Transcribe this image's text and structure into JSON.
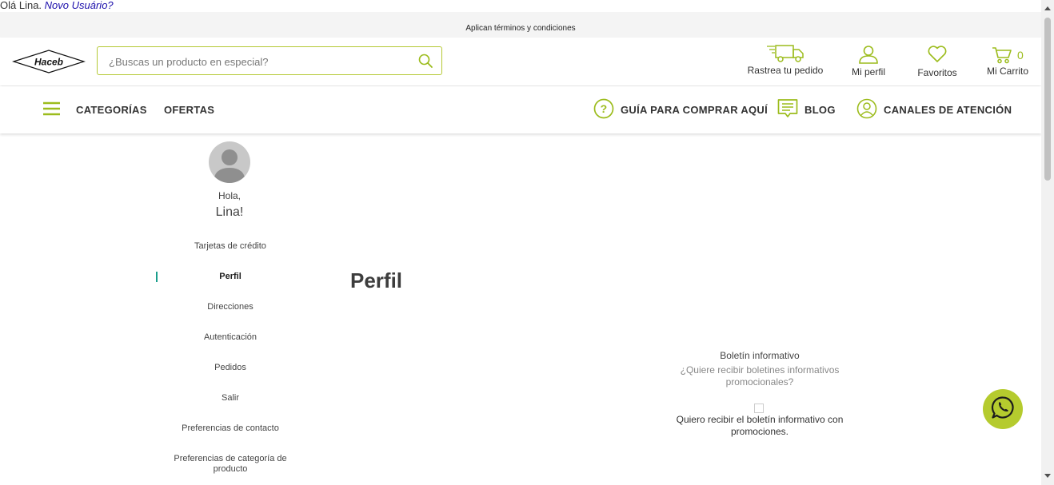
{
  "greeting": {
    "text": "Olá Lina.",
    "link": "Novo Usuário?"
  },
  "promo_bar": {
    "text": "Aplican términos y condiciones"
  },
  "header": {
    "logo_text": "Haceb",
    "search_placeholder": "¿Buscas un producto en especial?",
    "track_order": "Rastrea tu pedido",
    "my_profile": "Mi perfil",
    "favorites": "Favoritos",
    "cart": "Mi Carrito",
    "cart_count": "0"
  },
  "nav": {
    "categories": "CATEGORÍAS",
    "offers": "OFERTAS",
    "guide": "GUÍA PARA COMPRAR AQUÍ",
    "blog": "BLOG",
    "channels": "CANALES DE ATENCIÓN"
  },
  "sidebar": {
    "hello": "Hola,",
    "name": "Lina!",
    "items": [
      {
        "label": "Tarjetas de crédito"
      },
      {
        "label": "Perfil"
      },
      {
        "label": "Direcciones"
      },
      {
        "label": "Autenticación"
      },
      {
        "label": "Pedidos"
      },
      {
        "label": "Salir"
      },
      {
        "label": "Preferencias de contacto"
      },
      {
        "label": "Preferencias de categoría de producto"
      }
    ]
  },
  "main": {
    "title": "Perfil",
    "newsletter": {
      "heading": "Boletín informativo",
      "question": "¿Quiere recibir boletines informativos promocionales?",
      "checkbox_label": "Quiero recibir el boletín informativo con promociones."
    }
  },
  "colors": {
    "accent": "#b5cb2e",
    "active_marker": "#1a9e8c",
    "promo_bg": "#f4f4f4"
  }
}
